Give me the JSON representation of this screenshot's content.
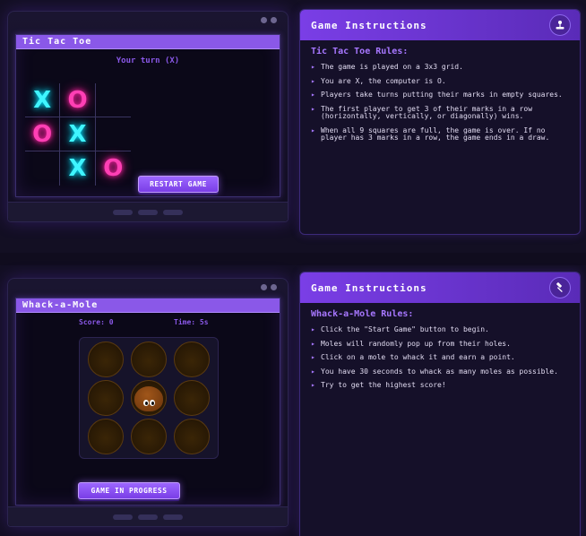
{
  "tictactoe": {
    "window_title": "Tic Tac Toe",
    "turn_text": "Your turn (X)",
    "board": [
      "X",
      "O",
      "",
      "O",
      "X",
      "",
      "",
      "X",
      "O"
    ],
    "restart_label": "RESTART GAME",
    "instructions": {
      "header": "Game Instructions",
      "header_icon": "joystick-icon",
      "rules_title": "Tic Tac Toe Rules:",
      "rules": [
        "The game is played on a 3x3 grid.",
        "You are X, the computer is O.",
        "Players take turns putting their marks in empty squares.",
        "The first player to get 3 of their marks in a row (horizontally, vertically, or diagonally) wins.",
        "When all 9 squares are full, the game is over. If no player has 3 marks in a row, the game ends in a draw."
      ]
    }
  },
  "whackamole": {
    "window_title": "Whack-a-Mole",
    "score_text": "Score: 0",
    "time_text": "Time: 5s",
    "holes": [
      false,
      false,
      false,
      false,
      true,
      false,
      false,
      false,
      false
    ],
    "status_button_label": "GAME IN PROGRESS",
    "instructions": {
      "header": "Game Instructions",
      "header_icon": "hammer-icon",
      "rules_title": "Whack-a-Mole Rules:",
      "rules": [
        "Click the \"Start Game\" button to begin.",
        "Moles will randomly pop up from their holes.",
        "Click on a mole to whack it and earn a point.",
        "You have 30 seconds to whack as many moles as possible.",
        "Try to get the highest score!"
      ]
    }
  },
  "colors": {
    "accent": "#8a58e8",
    "x_mark": "#3ff5ff",
    "o_mark": "#ff3fb4",
    "background": "#100c1e"
  }
}
